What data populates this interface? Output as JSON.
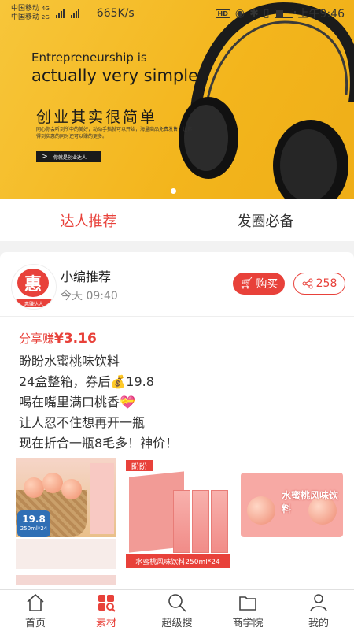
{
  "status_bar": {
    "carrier1": "中国移动",
    "carrier2": "中国移动",
    "net1": "4G",
    "net2": "2G",
    "speed": "665K/s",
    "hd": "HD",
    "time": "上午9:46",
    "battery_level": 0.55
  },
  "banner": {
    "en_line1": "Entrepreneurship is",
    "en_line2": "actually very simple",
    "cn_title": "创业其实很简单",
    "desc": "同心你会听到所中的美好，动动手指就可以开始，海量商品免费发售，让你得到实惠的同时还可以赚的更多。",
    "button_label": "你就是创业达人",
    "slide_index": 0
  },
  "tabs": [
    {
      "label": "达人推荐",
      "active": true
    },
    {
      "label": "发圈必备",
      "active": false
    }
  ],
  "post": {
    "avatar_char": "惠",
    "avatar_sub": "惠赚达人",
    "author": "小编推荐",
    "time": "今天 09:40",
    "buy_label": "购买",
    "share_count": "258",
    "earn_label": "分享赚",
    "earn_amount": "¥3.16",
    "lines": [
      "盼盼水蜜桃味饮料",
      "24盒整箱，券后💰19.8",
      "喝在嘴里满口桃香💝",
      "让人忍不住想再开一瓶",
      "现在折合一瓶8毛多！神价！"
    ],
    "photo1_price": "19.8",
    "photo1_size": "250ml*24",
    "photo2_logo": "盼盼",
    "photo2_strip": "水蜜桃风味饮料250ml*24",
    "photo3_label": "水蜜桃风味饮料"
  },
  "nav": [
    {
      "label": "首页",
      "icon": "home-icon",
      "active": false
    },
    {
      "label": "素材",
      "icon": "material-icon",
      "active": true
    },
    {
      "label": "超级搜",
      "icon": "search-icon",
      "active": false
    },
    {
      "label": "商学院",
      "icon": "folder-icon",
      "active": false
    },
    {
      "label": "我的",
      "icon": "user-icon",
      "active": false
    }
  ],
  "colors": {
    "accent": "#e8413a",
    "banner": "#f3b51c"
  }
}
